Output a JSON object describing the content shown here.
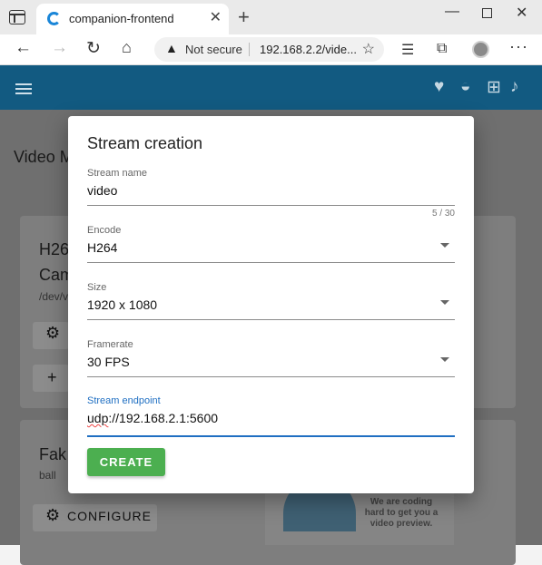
{
  "browser": {
    "tab_title": "companion-frontend",
    "tab_close": "✕",
    "new_tab": "+",
    "address": {
      "security_label": "Not secure",
      "url": "192.168.2.2/vide..."
    },
    "window": {
      "minimize": "—",
      "close": "✕"
    }
  },
  "app": {
    "page_title": "Video M",
    "dialog": {
      "title": "Stream creation",
      "stream_name": {
        "label": "Stream name",
        "value": "video",
        "counter": "5 / 30"
      },
      "encode": {
        "label": "Encode",
        "value": "H264"
      },
      "size": {
        "label": "Size",
        "value": "1920 x 1080"
      },
      "framerate": {
        "label": "Framerate",
        "value": "30 FPS"
      },
      "endpoint": {
        "label": "Stream endpoint",
        "value_prefix": "udp",
        "value_rest": "://192.168.2.1:5600"
      },
      "create_label": "CREATE"
    },
    "background_cards": {
      "card1": {
        "line1": "H26",
        "line2": "Cam",
        "line3": "/dev/v",
        "btn2": "+ "
      },
      "card2": {
        "line1": "Fak",
        "line2": "ball",
        "configure": "CONFIGURE"
      },
      "preview_text": "We are coding hard to get you a video preview."
    }
  }
}
